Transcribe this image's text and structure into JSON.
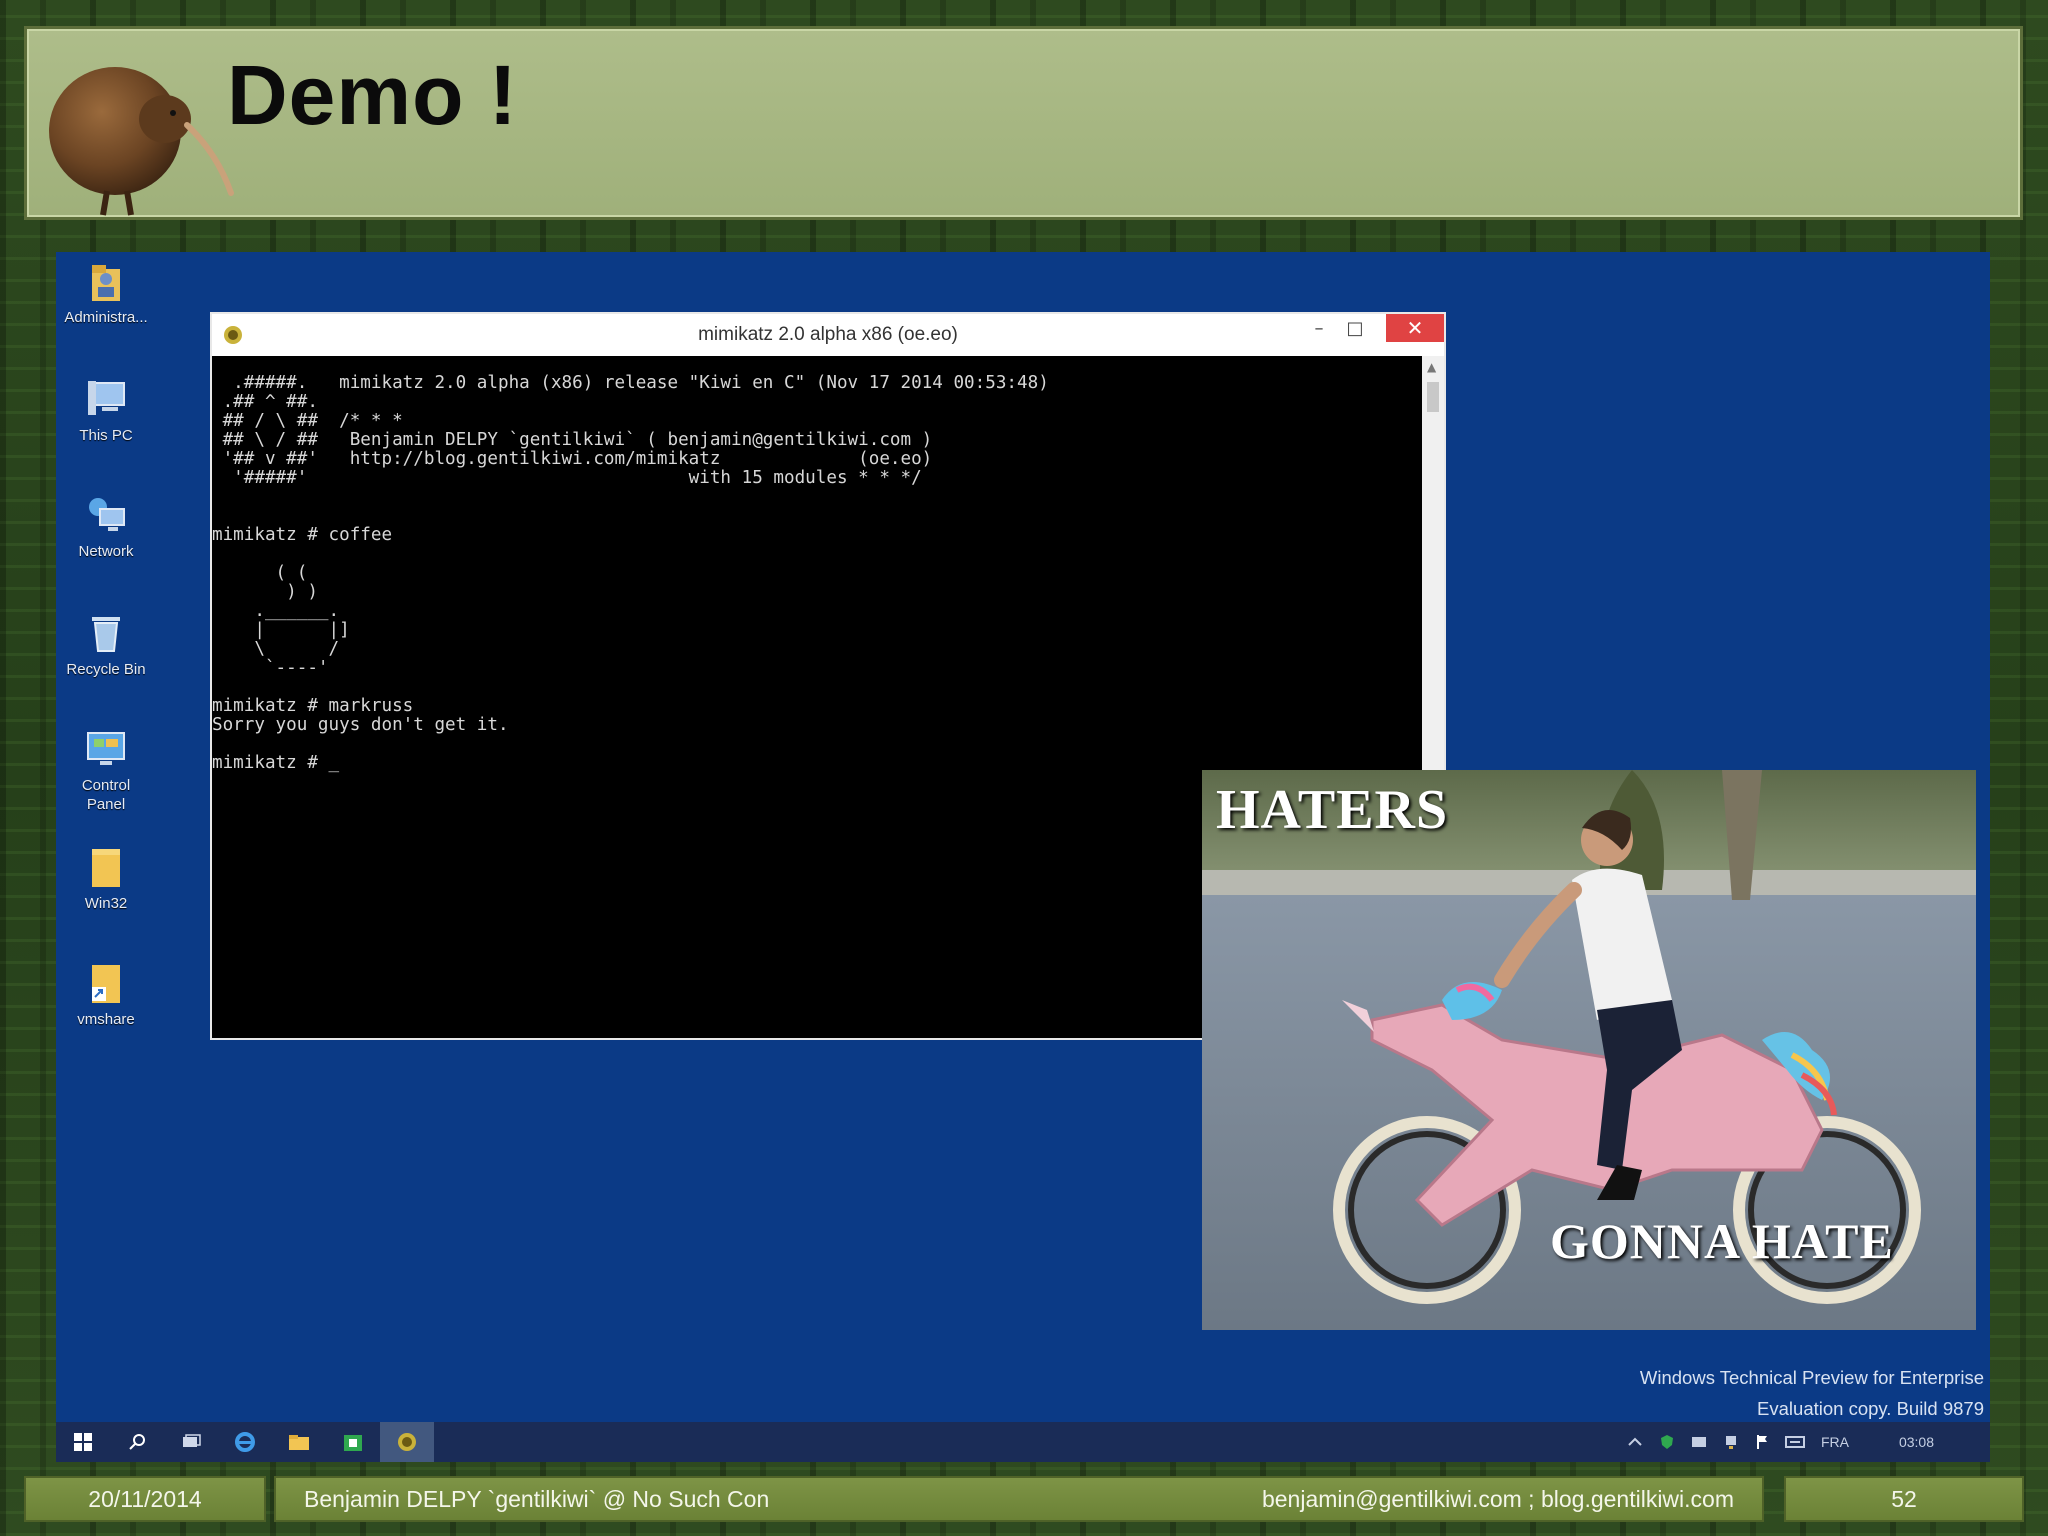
{
  "slide": {
    "title": "Demo !",
    "footer": {
      "date": "20/11/2014",
      "author": "Benjamin DELPY `gentilkiwi` @ No Such Con",
      "contact": "benjamin@gentilkiwi.com ; blog.gentilkiwi.com",
      "page": "52"
    }
  },
  "desktop": {
    "icons": [
      {
        "name": "administrator-folder",
        "label": "Administra..."
      },
      {
        "name": "this-pc",
        "label": "This PC"
      },
      {
        "name": "network",
        "label": "Network"
      },
      {
        "name": "recycle-bin",
        "label": "Recycle Bin"
      },
      {
        "name": "control-panel",
        "label": "Control\nPanel"
      },
      {
        "name": "win32-folder",
        "label": "Win32"
      },
      {
        "name": "vmshare-folder",
        "label": "vmshare"
      }
    ],
    "watermark": {
      "line1": "Windows Technical Preview for Enterprise",
      "line2": "Evaluation copy. Build 9879"
    }
  },
  "console": {
    "title": "mimikatz 2.0 alpha x86 (oe.eo)",
    "controls": {
      "minimize": "–",
      "maximize": "□",
      "close": "✕"
    },
    "output": "  .#####.   mimikatz 2.0 alpha (x86) release \"Kiwi en C\" (Nov 17 2014 00:53:48)\n .## ^ ##.\n ## / \\ ##  /* * *\n ## \\ / ##   Benjamin DELPY `gentilkiwi` ( benjamin@gentilkiwi.com )\n '## v ##'   http://blog.gentilkiwi.com/mimikatz             (oe.eo)\n  '#####'                                    with 15 modules * * */\n\n\nmimikatz # coffee\n\n      ( (\n       ) )\n    .______.\n    |      |]\n    \\      /\n     `----'\n\nmimikatz # markruss\nSorry you guys don't get it.\n\nmimikatz # _"
  },
  "meme": {
    "top_text": "HATERS",
    "bottom_text": "GONNA HATE"
  },
  "taskbar": {
    "language": "FRA",
    "clock": "03:08"
  },
  "colors": {
    "desktop_bg": "#0b3a86",
    "header_bg": "#a8b886",
    "footer_bg": "#748c3e",
    "close_button": "#e04343"
  }
}
